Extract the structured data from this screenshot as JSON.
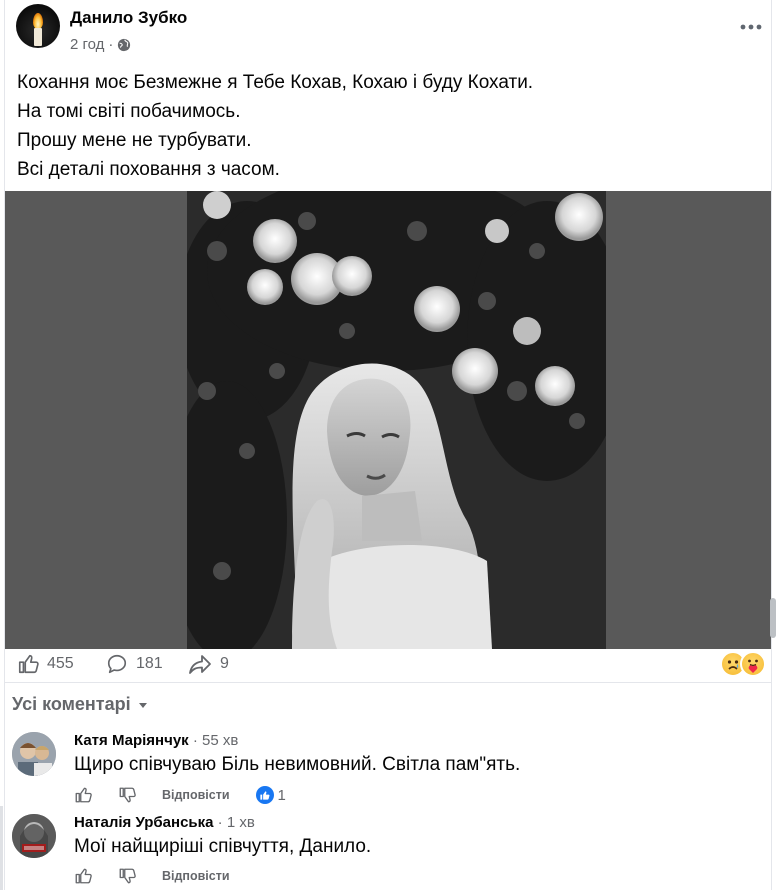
{
  "post": {
    "author": "Данило Зубко",
    "time": "2 год",
    "dot": "·",
    "privacy_icon": "globe-icon",
    "more_icon": "more-horizontal-icon",
    "text_lines": [
      "Кохання моє Безмежне я Тебе Кохав, Кохаю і буду Кохати.",
      "На томі світі побачимось.",
      "Прошу мене не турбувати.",
      "Всі деталі поховання з часом."
    ],
    "photo": {
      "description_icon": "memorial-photo"
    }
  },
  "stats": {
    "likes": "455",
    "comments": "181",
    "shares": "9",
    "reaction_icons": [
      "sad-reaction-icon",
      "care-reaction-icon"
    ]
  },
  "comments_section": {
    "header": "Усі коментарі",
    "items": [
      {
        "name": "Катя Маріянчук",
        "time": "55 хв",
        "text": "Щиро співчуваю Біль невимовний. Світла пам\"ять.",
        "reply_label": "Відповісти",
        "like_count": "1"
      },
      {
        "name": "Наталія Урбанська",
        "time": "1 хв",
        "text": "Мої найщиріші співчуття, Данило.",
        "reply_label": "Відповісти"
      }
    ]
  },
  "colors": {
    "accent": "#1877f2",
    "secondary_text": "#65676b",
    "photo_background": "#595959"
  }
}
